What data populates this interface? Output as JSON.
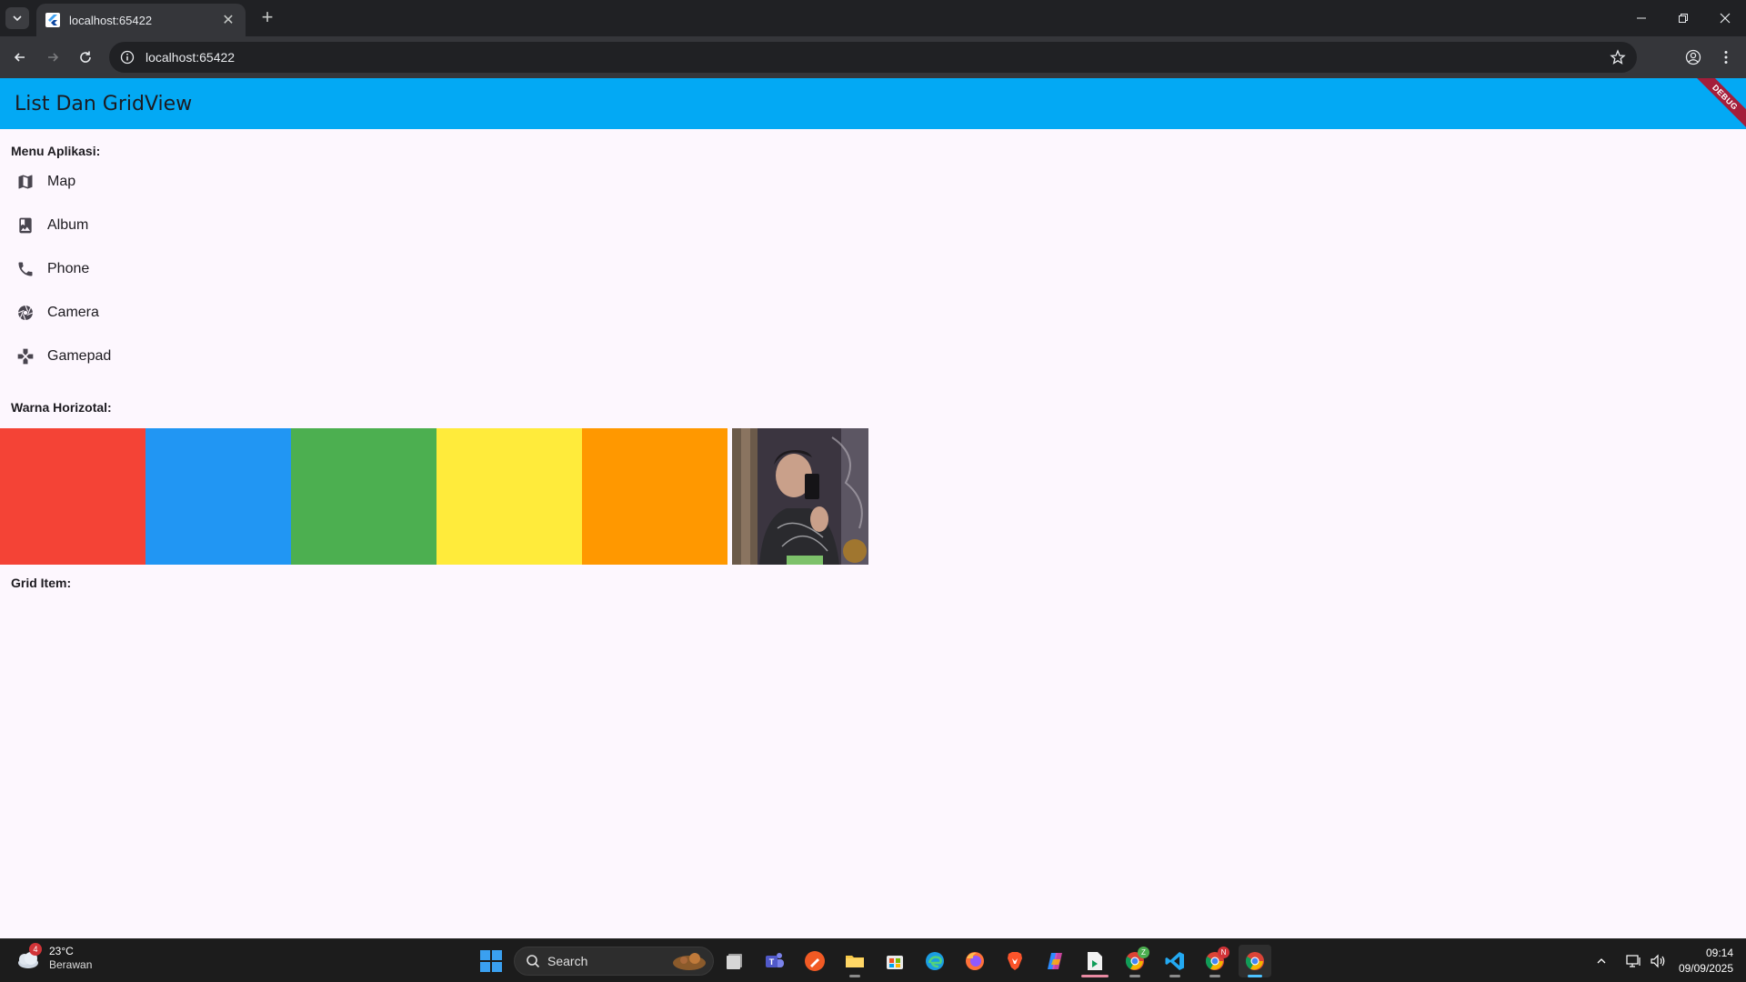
{
  "browser": {
    "tab_title": "localhost:65422",
    "url": "localhost:65422"
  },
  "app": {
    "title": "List Dan GridView",
    "debug_label": "DEBUG",
    "menu_section_label": "Menu Aplikasi:",
    "menu_items": [
      {
        "label": "Map",
        "icon": "map-icon"
      },
      {
        "label": "Album",
        "icon": "album-icon"
      },
      {
        "label": "Phone",
        "icon": "phone-icon"
      },
      {
        "label": "Camera",
        "icon": "camera-icon"
      },
      {
        "label": "Gamepad",
        "icon": "gamepad-icon"
      }
    ],
    "colors_section_label": "Warna Horizotal:",
    "colors": [
      "#f44336",
      "#2196f3",
      "#4caf50",
      "#ffeb3b",
      "#ff9800"
    ],
    "grid_section_label": "Grid Item:",
    "appbar_color": "#03a9f4"
  },
  "taskbar": {
    "weather_temp": "23°C",
    "weather_condition": "Berawan",
    "weather_badge": "4",
    "search_label": "Search",
    "clock_time": "09:14",
    "clock_date": "09/09/2025"
  }
}
